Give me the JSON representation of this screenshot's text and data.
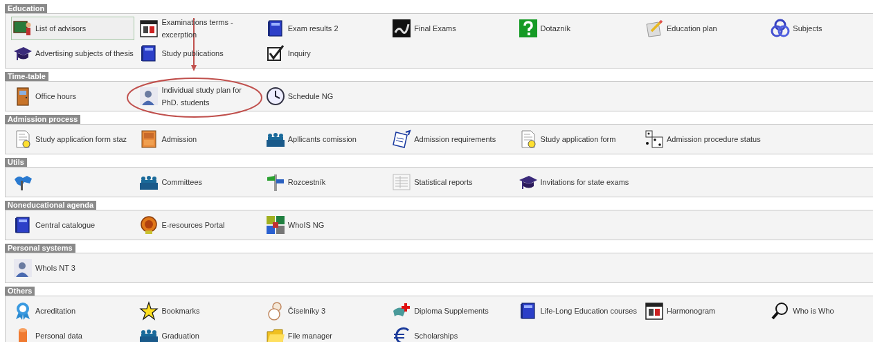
{
  "sections": [
    {
      "title": "Education",
      "items": [
        {
          "label": "List of advisors",
          "selected": true
        },
        {
          "label": "Examinations terms - excerption",
          "selected": false
        },
        {
          "label": "Exam results 2",
          "selected": false
        },
        {
          "label": "Final Exams",
          "selected": false
        },
        {
          "label": "Dotazník",
          "selected": false
        },
        {
          "label": "Education plan",
          "selected": false
        },
        {
          "label": "Subjects",
          "selected": false
        },
        {
          "label": "Advertising subjects of thesis",
          "selected": false
        },
        {
          "label": "Study publications",
          "selected": false
        },
        {
          "label": "Inquiry",
          "selected": false
        }
      ]
    },
    {
      "title": "Time-table",
      "items": [
        {
          "label": "Office hours",
          "selected": false
        },
        {
          "label": "Individual study plan for PhD. students",
          "selected": false
        },
        {
          "label": "Schedule NG",
          "selected": false
        }
      ]
    },
    {
      "title": "Admission process",
      "items": [
        {
          "label": "Study application form staz",
          "selected": false
        },
        {
          "label": "Admission",
          "selected": false
        },
        {
          "label": "Apllicants comission",
          "selected": false
        },
        {
          "label": "Admission requirements",
          "selected": false
        },
        {
          "label": "Study application form",
          "selected": false
        },
        {
          "label": "Admission procedure status",
          "selected": false
        }
      ]
    },
    {
      "title": "Utils",
      "items": [
        {
          "selected": false
        },
        {
          "label": "Committees",
          "selected": false
        },
        {
          "label": "Rozcestník",
          "selected": false
        },
        {
          "label": "Statistical reports",
          "selected": false
        },
        {
          "label": "Invitations for state exams",
          "selected": false
        }
      ]
    },
    {
      "title": "Noneducational agenda",
      "items": [
        {
          "label": "Central catalogue",
          "selected": false
        },
        {
          "label": "E-resources Portal",
          "selected": false
        },
        {
          "label": "WhoIS NG",
          "selected": false
        }
      ]
    },
    {
      "title": "Personal systems",
      "items": [
        {
          "label": "WhoIs NT 3",
          "selected": false
        }
      ]
    },
    {
      "title": "Others",
      "items": [
        {
          "label": "Acreditation",
          "selected": false
        },
        {
          "label": "Bookmarks",
          "selected": false
        },
        {
          "label": "Číselníky 3",
          "selected": false
        },
        {
          "label": "Diploma Supplements",
          "selected": false
        },
        {
          "label": "Life-Long Education courses",
          "selected": false
        },
        {
          "label": "Harmonogram",
          "selected": false
        },
        {
          "label": "Who is Who",
          "selected": false
        },
        {
          "label": "Personal data",
          "selected": false
        },
        {
          "label": "Graduation",
          "selected": false
        },
        {
          "label": "File manager",
          "selected": false
        },
        {
          "label": "Scholarships",
          "selected": false
        }
      ]
    }
  ]
}
